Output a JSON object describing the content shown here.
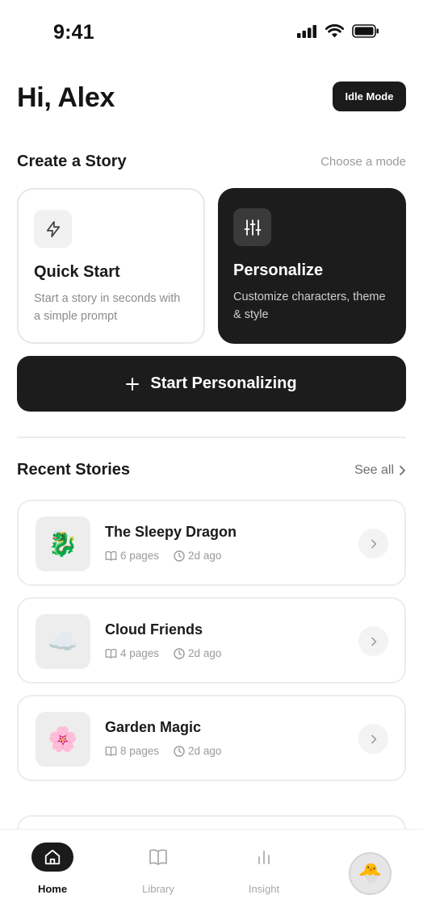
{
  "status_bar": {
    "time": "9:41"
  },
  "header": {
    "greeting": "Hi, Alex",
    "idle_mode_label": "Idle Mode"
  },
  "create_section": {
    "title": "Create a Story",
    "hint": "Choose a mode",
    "quick_start": {
      "title": "Quick Start",
      "description": "Start a story in seconds with a simple prompt",
      "icon": "lightning-icon"
    },
    "personalize": {
      "title": "Personalize",
      "description": "Customize characters, theme & style",
      "icon": "sliders-icon"
    },
    "cta_label": "Start Personalizing"
  },
  "recent_section": {
    "title": "Recent Stories",
    "see_all_label": "See all",
    "stories": [
      {
        "title": "The Sleepy Dragon",
        "pages": "6 pages",
        "age": "2d ago",
        "thumb": "🐉"
      },
      {
        "title": "Cloud Friends",
        "pages": "4 pages",
        "age": "2d ago",
        "thumb": "☁️"
      },
      {
        "title": "Garden Magic",
        "pages": "8 pages",
        "age": "2d ago",
        "thumb": "🌸"
      }
    ]
  },
  "tabbar": {
    "tabs": [
      {
        "label": "Home",
        "icon": "home-icon",
        "active": true
      },
      {
        "label": "Library",
        "icon": "book-icon",
        "active": false
      },
      {
        "label": "Insight",
        "icon": "bar-chart-icon",
        "active": false
      }
    ],
    "avatar": "🐣"
  },
  "colors": {
    "primary_dark": "#1c1c1c",
    "muted_text": "#9a9a9a",
    "card_border": "#ececec"
  }
}
